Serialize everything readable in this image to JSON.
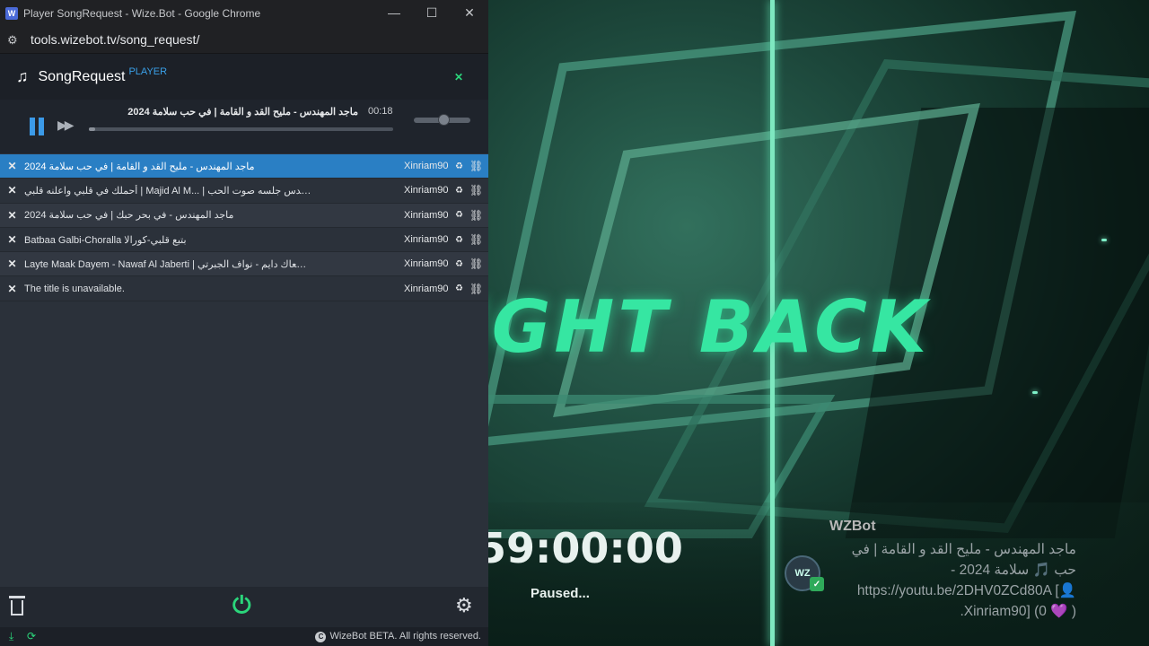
{
  "browser": {
    "window_title": "Player SongRequest - Wize.Bot - Google Chrome",
    "favicon_text": "W",
    "url": "tools.wizebot.tv/song_request/",
    "controls": {
      "minimize": "—",
      "maximize": "☐",
      "close": "✕"
    }
  },
  "app": {
    "brand": "SongRequest",
    "brand_sub": "PLAYER",
    "header_close": "✕",
    "player": {
      "title": "ماجد المهندس - مليح القد و القامة | في حب سلامة 2024",
      "time": "00:18",
      "progress_fraction": 0.02,
      "volume_fraction": 0.52
    },
    "queue": [
      {
        "title": "ماجد المهندس - مليح القد و القامة | في حب سلامة 2024",
        "requester": "Xinriam90",
        "active": true
      },
      {
        "title": "أحملك في قلبي واعلنه قلبي | Majid Al M... | ماجد المهندس جلسه صوت الحب",
        "requester": "Xinriam90",
        "active": false
      },
      {
        "title": "ماجد المهندس - في بحر حبك | في حب سلامة 2024",
        "requester": "Xinriam90",
        "active": false
      },
      {
        "title": "Batbaa Galbi-Choralla بتبع قلبي-كورالا",
        "requester": "Xinriam90",
        "active": false
      },
      {
        "title": "Layte Maak Dayem - Nawaf Al Jaberti | ليتي معاك دايم - نواف الجبرتي",
        "requester": "Xinriam90",
        "active": false
      },
      {
        "title": "The title is unavailable.",
        "requester": "Xinriam90",
        "active": false
      }
    ],
    "remove_glyph": "✕",
    "copyright": "WizeBot BETA. All rights reserved.",
    "copyright_mark": "C"
  },
  "stream": {
    "big_text": "IGHT BACK",
    "timer": "59:00:00",
    "status": "Paused...",
    "chat": {
      "username": "WZBot",
      "avatar_text": "WZ",
      "message": "ماجد المهندس - مليح القد و القامة | في حب 🎵 سلامة 2024 - https://youtu.be/2DHV0ZCd80A [👤 Xinriam90] (0 💜 )."
    }
  },
  "colors": {
    "accent_blue": "#2a7fc4",
    "accent_green": "#2bd67b",
    "neon_green": "#36e6a2"
  }
}
